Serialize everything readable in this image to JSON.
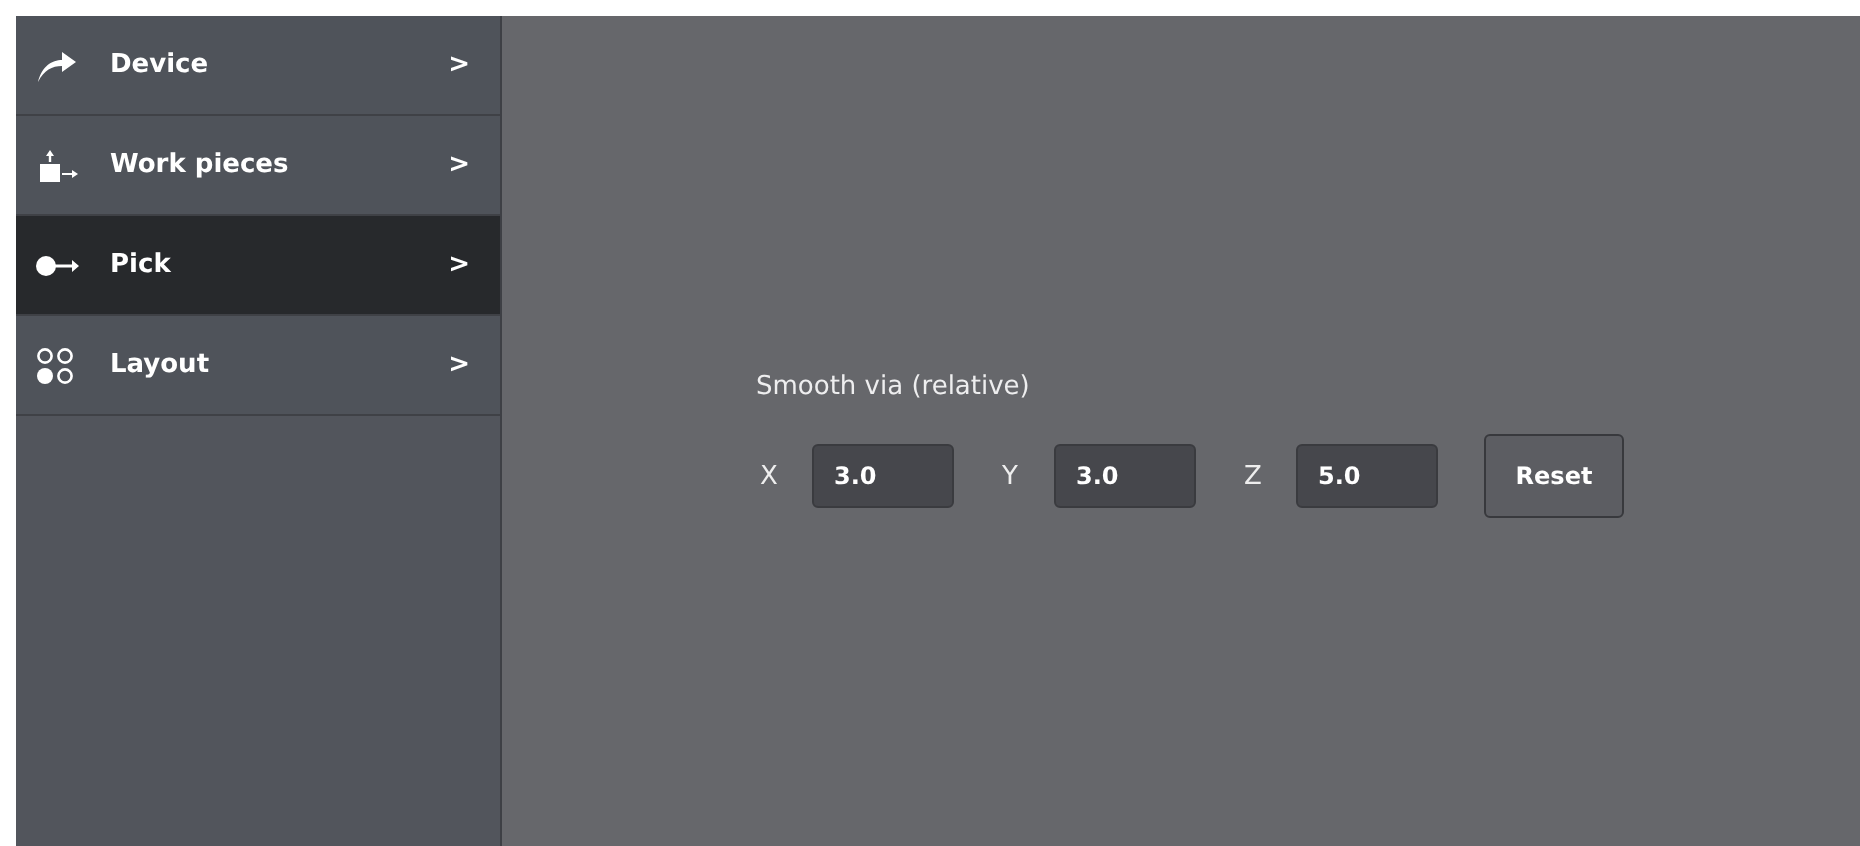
{
  "sidebar": {
    "items": [
      {
        "label": "Device",
        "kind": "arrow",
        "selected": false,
        "chevron": ">"
      },
      {
        "label": "Work pieces",
        "kind": "workpiece",
        "selected": false,
        "chevron": ">"
      },
      {
        "label": "Pick",
        "kind": "pick",
        "selected": true,
        "chevron": ">"
      },
      {
        "label": "Layout",
        "kind": "layout",
        "selected": false,
        "chevron": ">"
      }
    ]
  },
  "panel": {
    "title": "Smooth via (relative)",
    "fields": [
      {
        "label": "X",
        "value": "3.0"
      },
      {
        "label": "Y",
        "value": "3.0"
      },
      {
        "label": "Z",
        "value": "5.0"
      }
    ],
    "button": "Reset"
  }
}
